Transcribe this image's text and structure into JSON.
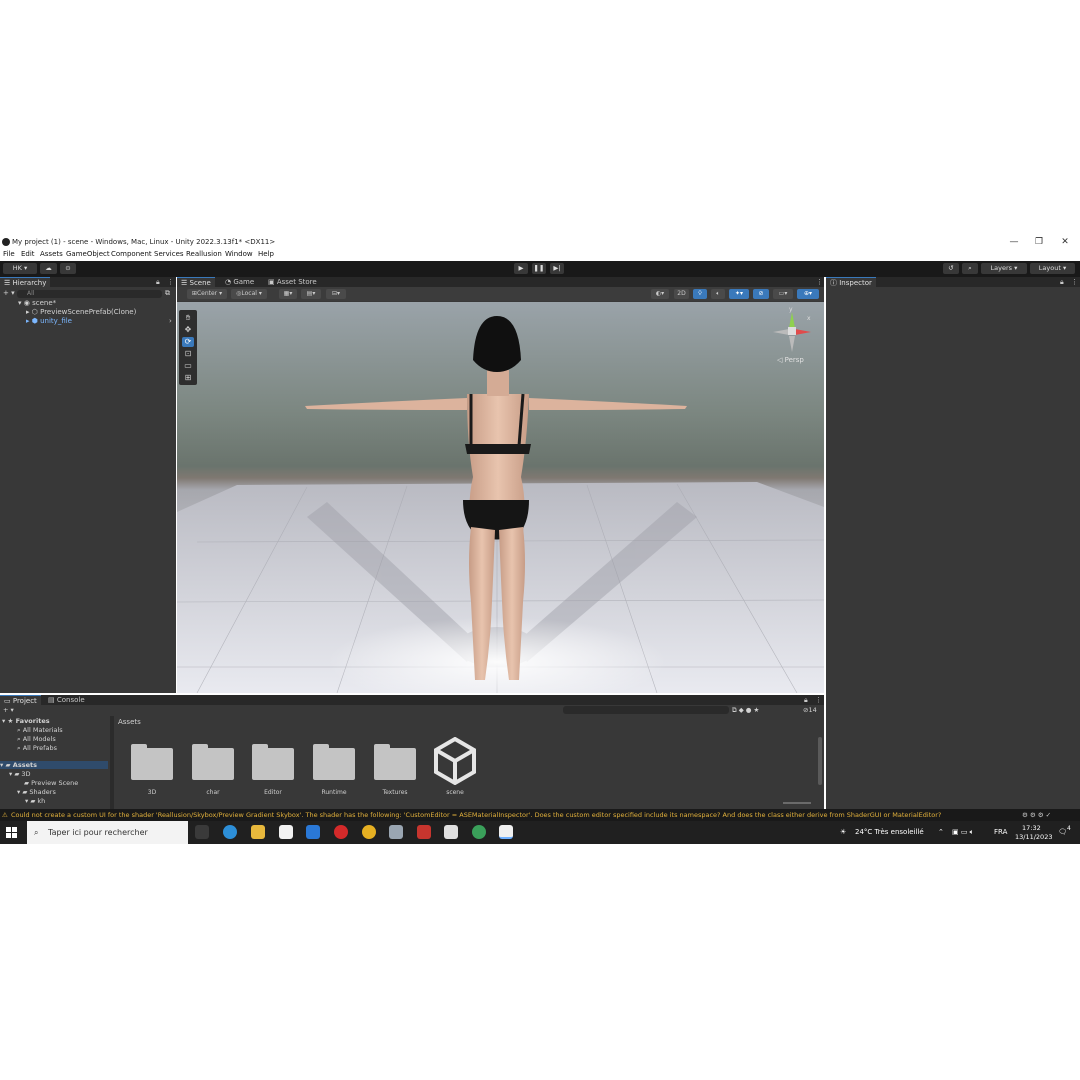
{
  "window": {
    "title": "My project (1) - scene - Windows, Mac, Linux - Unity 2022.3.13f1* <DX11>",
    "minimize": "—",
    "maximize": "❐",
    "close": "✕"
  },
  "menu": [
    "File",
    "Edit",
    "Assets",
    "GameObject",
    "Component",
    "Services",
    "Reallusion",
    "Window",
    "Help"
  ],
  "toolbar": {
    "account": "HK ▾",
    "layers": "Layers",
    "layout": "Layout"
  },
  "hierarchy": {
    "tab": "Hierarchy",
    "add": "+ ▾",
    "search_placeholder": "All",
    "items": [
      {
        "label": "scene*",
        "indent": 0
      },
      {
        "label": "PreviewScenePrefab(Clone)",
        "indent": 1
      },
      {
        "label": "unity_file",
        "indent": 1
      }
    ]
  },
  "scene": {
    "tabs": [
      "Scene",
      "Game",
      "Asset Store"
    ],
    "pivot": "Center",
    "space": "Local",
    "mode_2d": "2D",
    "persp_label": "◁ Persp",
    "gizmo_y": "y",
    "gizmo_x": "x"
  },
  "inspector": {
    "tab": "Inspector"
  },
  "project": {
    "tabs": [
      "Project",
      "Console"
    ],
    "add": "+ ▾",
    "hidden_count": "14",
    "breadcrumb": "Assets",
    "sidebar": [
      {
        "label": "Favorites",
        "kind": "header"
      },
      {
        "label": "All Materials",
        "kind": "search"
      },
      {
        "label": "All Models",
        "kind": "search"
      },
      {
        "label": "All Prefabs",
        "kind": "search"
      },
      {
        "label": "Assets",
        "kind": "header"
      },
      {
        "label": "3D",
        "kind": "folder"
      },
      {
        "label": "Preview Scene",
        "kind": "folder"
      },
      {
        "label": "Shaders",
        "kind": "folder"
      },
      {
        "label": "kh",
        "kind": "folder"
      }
    ],
    "assets": [
      "3D",
      "char",
      "Editor",
      "Runtime",
      "Textures",
      "scene"
    ]
  },
  "status": {
    "message": "Could not create a custom UI for the shader 'Reallusion/Skybox/Preview Gradient Skybox'. The shader has the following: 'CustomEditor = ASEMaterialInspector'. Does the custom editor specified include its namespace? And does the class either derive from ShaderGUI or MaterialEditor?"
  },
  "taskbar": {
    "search_placeholder": "Taper ici pour rechercher",
    "weather": "24°C  Très ensoleillé",
    "lang": "FRA",
    "time": "17:32",
    "date": "13/11/2023",
    "notifications": "4"
  },
  "colors": {
    "accent": "#3a79bb",
    "panel": "#383838",
    "dark": "#191919",
    "warning": "#e2b13c"
  }
}
